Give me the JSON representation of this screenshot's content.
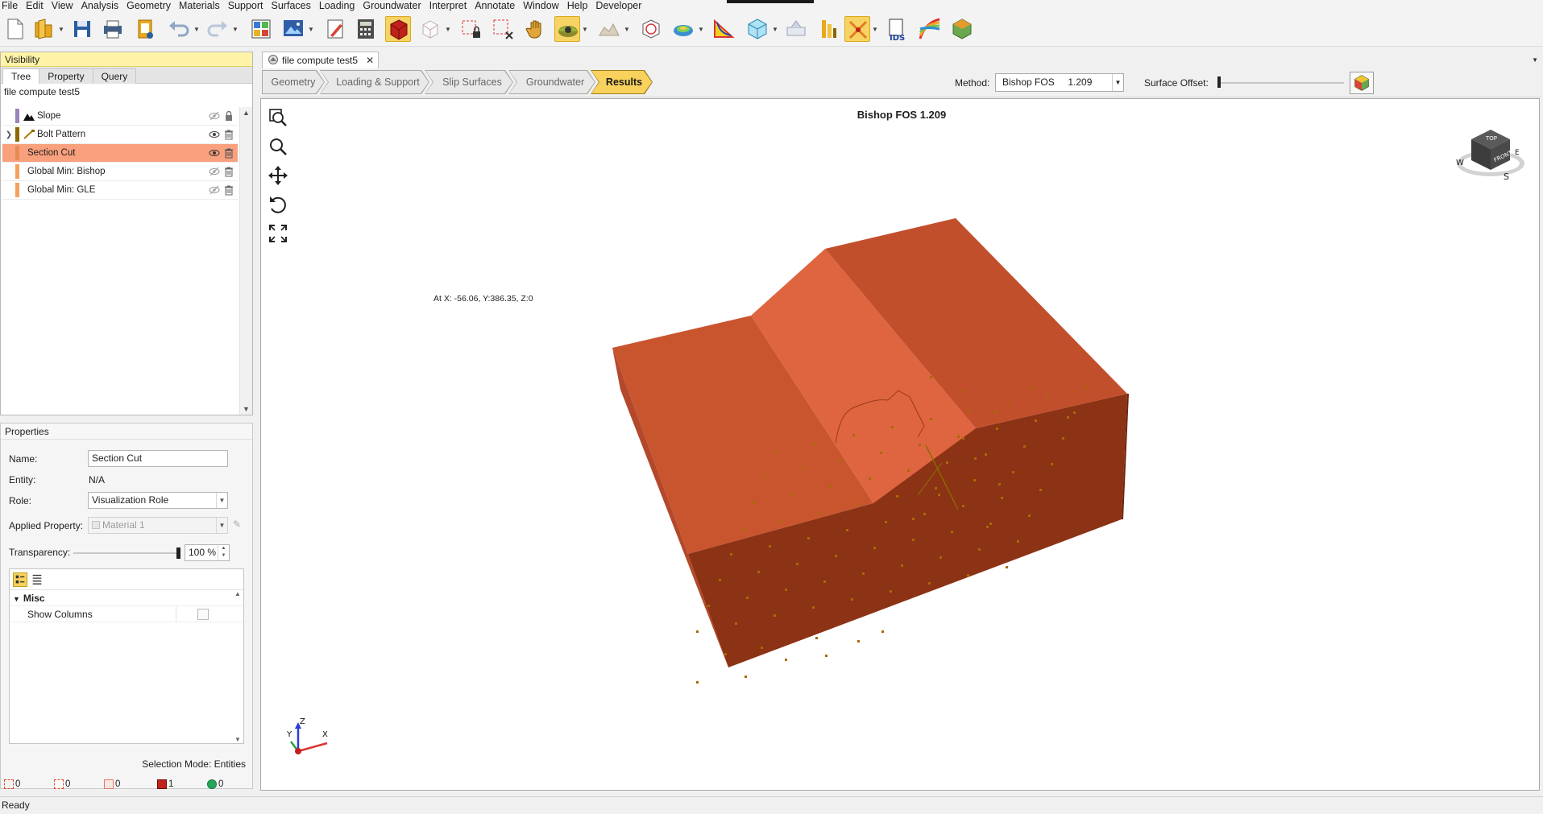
{
  "menu": [
    "File",
    "Edit",
    "View",
    "Analysis",
    "Geometry",
    "Materials",
    "Support",
    "Surfaces",
    "Loading",
    "Groundwater",
    "Interpret",
    "Annotate",
    "Window",
    "Help",
    "Developer"
  ],
  "visibility": {
    "header": "Visibility",
    "tabs": [
      "Tree",
      "Property",
      "Query"
    ],
    "document": "file compute test5",
    "items": [
      {
        "label": "Slope",
        "swatch": "#9a83b8"
      },
      {
        "label": "Bolt Pattern",
        "swatch": "#8f6800"
      },
      {
        "label": "Section Cut",
        "swatch": "#e88a54"
      },
      {
        "label": "Global Min: Bishop",
        "swatch": "#f5a25f"
      },
      {
        "label": "Global Min: GLE",
        "swatch": "#f5a25f"
      }
    ]
  },
  "properties": {
    "title": "Properties",
    "name_label": "Name:",
    "name_value": "Section Cut",
    "entity_label": "Entity:",
    "entity_value": "N/A",
    "role_label": "Role:",
    "role_value": "Visualization Role",
    "applied_label": "Applied Property:",
    "applied_value": "Material 1",
    "transparency_label": "Transparency:",
    "transparency_value": "100 %",
    "misc_category": "Misc",
    "show_columns_label": "Show Columns",
    "selection_mode": "Selection Mode: Entities",
    "counts": [
      "0",
      "0",
      "0",
      "1",
      "0"
    ]
  },
  "document_tab": {
    "title": "file compute test5",
    "close": "✕"
  },
  "workflow": {
    "steps": [
      "Geometry",
      "Loading & Support",
      "Slip Surfaces",
      "Groundwater",
      "Results"
    ],
    "active_step": "Results",
    "method_label": "Method:",
    "method_value": "Bishop FOS     1.209",
    "offset_label": "Surface Offset:",
    "surface_offset": 0
  },
  "viewport": {
    "title": "Bishop FOS 1.209",
    "coords": "At X: -56.06, Y:386.35, Z:0",
    "navcube": {
      "top": "TOP",
      "front": "FRONT",
      "e": "E",
      "w": "W",
      "s": "S"
    },
    "axes": {
      "x": "X",
      "y": "Y",
      "z": "Z"
    }
  },
  "colors": {
    "accent": "#f8d25c",
    "selection": "#f9a07d",
    "slope_top": "#c9552f",
    "slope_face": "#de6540",
    "slope_front": "#8c3215"
  },
  "status": "Ready"
}
